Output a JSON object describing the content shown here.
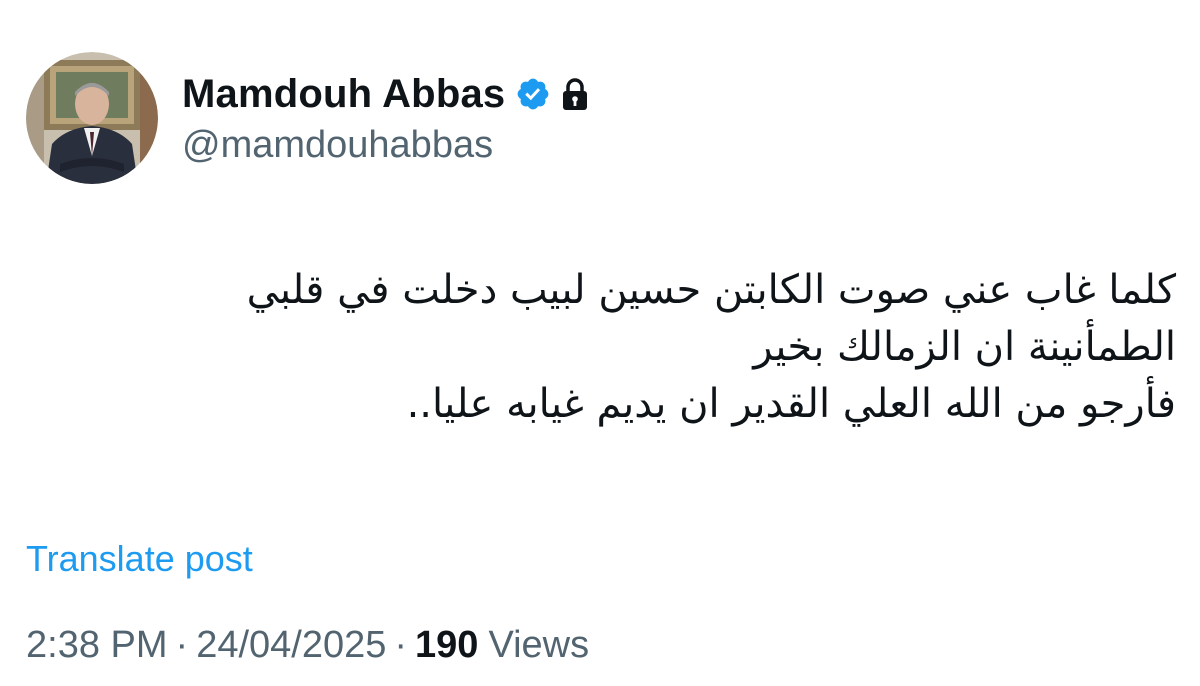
{
  "author": {
    "display_name": "Mamdouh Abbas",
    "handle": "@mamdouhabbas",
    "avatar_icon": "profile-photo",
    "verified_icon": "verified-badge-icon",
    "protected_icon": "lock-icon",
    "verified_color": "#1d9bf0"
  },
  "post": {
    "text_lines": [
      "كلما غاب عني صوت الكابتن حسين لبيب دخلت في قلبي",
      "الطمأنينة ان الزمالك بخير",
      "فأرجو من الله العلي القدير  ان يديم غيابه عليا.."
    ],
    "translate_label": "Translate post"
  },
  "meta": {
    "time": "2:38 PM",
    "separator": "·",
    "date": "24/04/2025",
    "views_count": "190",
    "views_label": "Views"
  },
  "colors": {
    "text_primary": "#0f1419",
    "text_secondary": "#536471",
    "link": "#1d9bf0",
    "background": "#ffffff"
  }
}
